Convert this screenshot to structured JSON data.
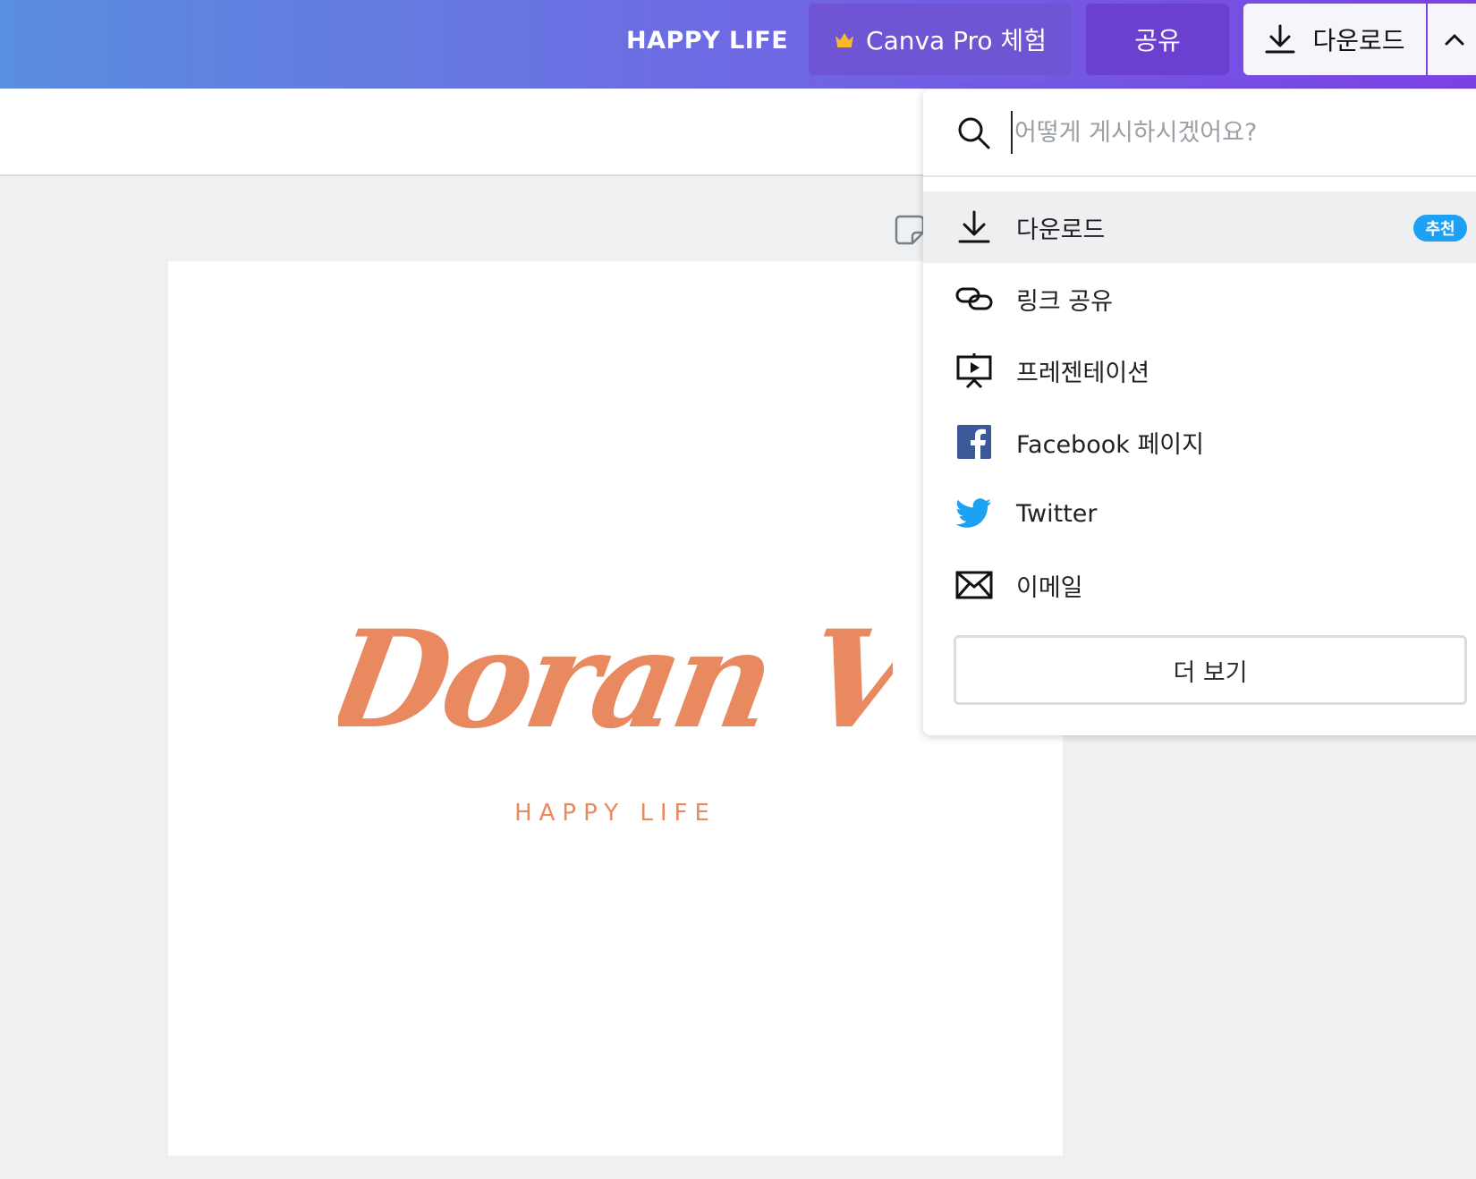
{
  "header": {
    "doc_title": "HAPPY LIFE",
    "pro_button": "Canva Pro 체험",
    "share_button": "공유",
    "download_button": "다운로드",
    "accent_gradient": [
      "#5a8ede",
      "#7b42e3"
    ]
  },
  "design": {
    "logo_text": "Doran Vlog",
    "subtitle": "HAPPY LIFE",
    "text_color": "#e8895f"
  },
  "dropdown": {
    "search_placeholder": "어떻게 게시하시겠어요?",
    "items": [
      {
        "label": "다운로드",
        "icon": "download-icon",
        "badge": "추천"
      },
      {
        "label": "링크 공유",
        "icon": "link-icon"
      },
      {
        "label": "프레젠테이션",
        "icon": "presentation-icon"
      },
      {
        "label": "Facebook 페이지",
        "icon": "facebook-icon"
      },
      {
        "label": "Twitter",
        "icon": "twitter-icon"
      },
      {
        "label": "이메일",
        "icon": "email-icon"
      }
    ],
    "more_button": "더 보기",
    "badge_color": "#1ea1f2"
  }
}
